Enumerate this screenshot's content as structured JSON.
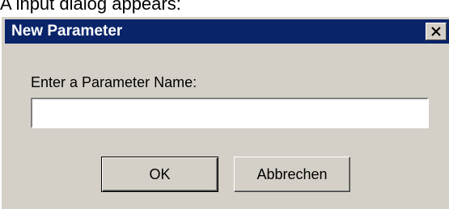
{
  "caption": "A input dialog appears:",
  "dialog": {
    "title": "New Parameter",
    "prompt": "Enter a Parameter Name:",
    "input_value": "",
    "ok_label": "OK",
    "cancel_label": "Abbrechen"
  }
}
